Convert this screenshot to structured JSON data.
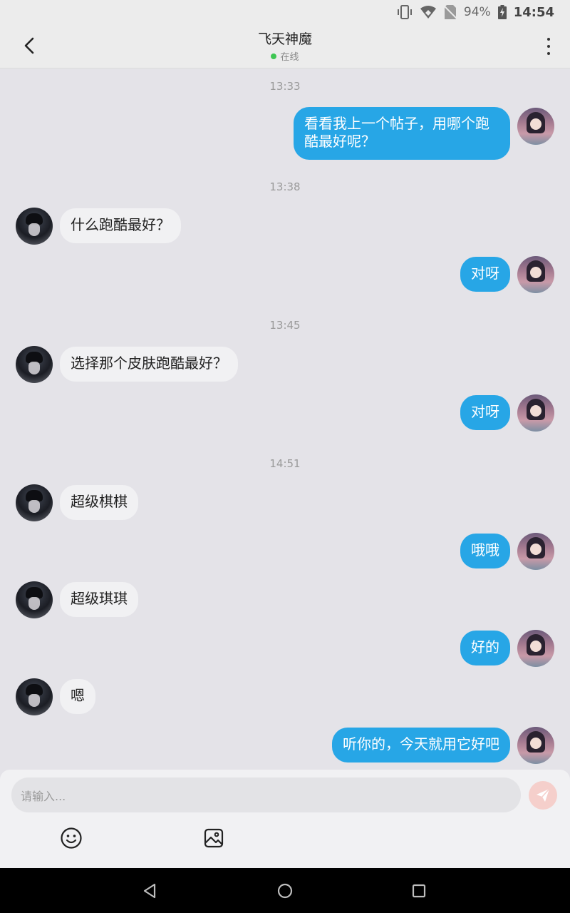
{
  "status_bar": {
    "battery": "94%",
    "time": "14:54",
    "icons": [
      "vibrate-icon",
      "wifi-icon",
      "no-sim-icon",
      "battery-charging-icon"
    ]
  },
  "header": {
    "title": "飞天神魔",
    "status": "在线",
    "status_color": "#3ec653"
  },
  "messages": [
    {
      "kind": "timestamp",
      "text": "13:33"
    },
    {
      "kind": "out",
      "text": "看看我上一个帖子，用哪个跑酷最好呢？"
    },
    {
      "kind": "timestamp",
      "text": "13:38"
    },
    {
      "kind": "in",
      "text": "什么跑酷最好？"
    },
    {
      "kind": "out",
      "text": "对呀"
    },
    {
      "kind": "timestamp",
      "text": "13:45"
    },
    {
      "kind": "in",
      "text": "选择那个皮肤跑酷最好？"
    },
    {
      "kind": "out",
      "text": "对呀"
    },
    {
      "kind": "timestamp",
      "text": "14:51"
    },
    {
      "kind": "in",
      "text": "超级棋棋"
    },
    {
      "kind": "out",
      "text": "哦哦"
    },
    {
      "kind": "in",
      "text": "超级琪琪"
    },
    {
      "kind": "out",
      "text": "好的"
    },
    {
      "kind": "in",
      "text": "嗯"
    },
    {
      "kind": "out",
      "text": "听你的，今天就用它好吧"
    }
  ],
  "composer": {
    "placeholder": "请输入...",
    "send_icon": "send-icon",
    "tools": [
      "emoji-icon",
      "image-icon"
    ]
  },
  "colors": {
    "outgoing_bubble": "#27a6e6",
    "incoming_bubble": "#f1f1f3",
    "background": "#e4e3e8"
  }
}
